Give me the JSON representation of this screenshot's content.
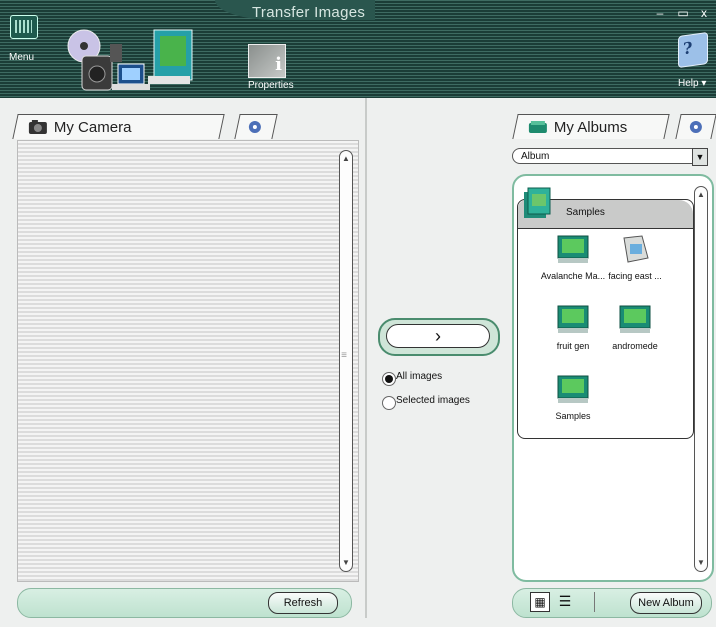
{
  "window": {
    "title": "Transfer Images",
    "minimize": "–",
    "maximize": "▭",
    "close": "x"
  },
  "toolbar": {
    "menu_label": "Menu",
    "properties_label": "Properties",
    "help_label": "Help ▾"
  },
  "left": {
    "tab_label": "My Camera",
    "refresh_label": "Refresh"
  },
  "middle": {
    "transfer_glyph": "›",
    "options": [
      {
        "label": "All images",
        "checked": true
      },
      {
        "label": "Selected images",
        "checked": false
      }
    ]
  },
  "right": {
    "tab_label": "My Albums",
    "select_value": "Album",
    "group_title": "Samples",
    "albums": [
      {
        "label": "Avalanche Ma...",
        "kind": "book"
      },
      {
        "label": "facing east ...",
        "kind": "scroll"
      },
      {
        "label": "fruit gen",
        "kind": "book"
      },
      {
        "label": "andromede",
        "kind": "book"
      },
      {
        "label": "Samples",
        "kind": "book"
      }
    ],
    "new_album_label": "New Album"
  },
  "colors": {
    "accent_green": "#4a8c6e",
    "titlebar": "#1b3d37",
    "panel_border": "#7fbba0"
  }
}
